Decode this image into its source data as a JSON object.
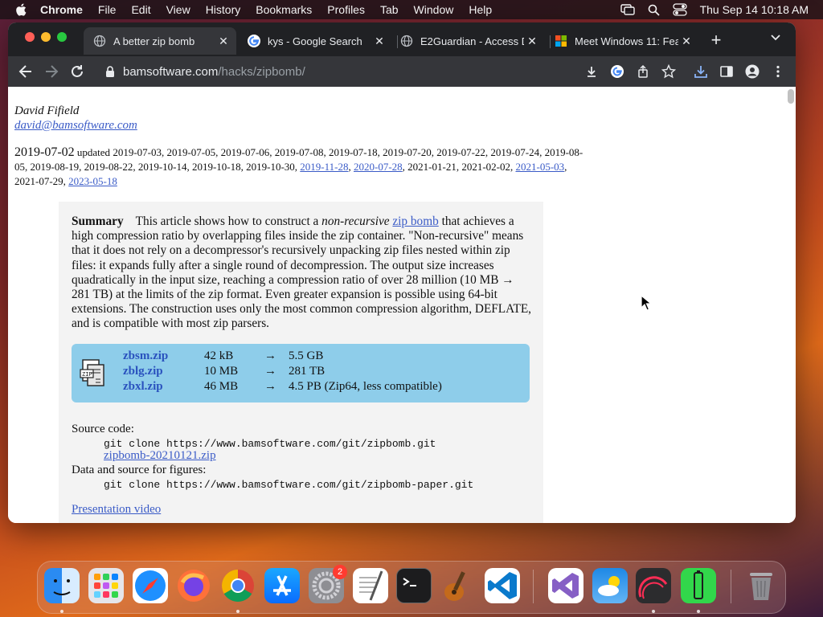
{
  "menubar": {
    "app": "Chrome",
    "items": [
      "File",
      "Edit",
      "View",
      "History",
      "Bookmarks",
      "Profiles",
      "Tab",
      "Window",
      "Help"
    ],
    "clock": "Thu Sep 14  10:18 AM"
  },
  "tabs": [
    {
      "title": "A better zip bomb",
      "favicon": "globe-icon",
      "active": true
    },
    {
      "title": "kys - Google Search",
      "favicon": "google-icon",
      "active": false
    },
    {
      "title": "E2Guardian - Access D",
      "favicon": "globe-icon",
      "active": false
    },
    {
      "title": "Meet Windows 11: Fea",
      "favicon": "microsoft-icon",
      "active": false
    }
  ],
  "address": {
    "host": "bamsoftware.com",
    "path": "/hacks/zipbomb/"
  },
  "page": {
    "author": "David Fifield",
    "email": "david@bamsoftware.com",
    "date_main": "2019-07-02",
    "updated_prefix": "updated",
    "updated_dates_plain1": "2019-07-03, 2019-07-05, 2019-07-06, 2019-07-08, 2019-07-18, 2019-07-20, 2019-07-22, 2019-07-24, 2019-08-05, 2019-08-19, 2019-08-22, 2019-10-14, 2019-10-18, 2019-10-30,",
    "link_date1": "2019-11-28",
    "link_date2": "2020-07-28",
    "updated_dates_plain2": ", 2021-01-21, 2021-02-02,",
    "link_date3": "2021-05-03",
    "updated_dates_plain3": "2021-07-29,",
    "link_date4": "2023-05-18",
    "summary_heading": "Summary",
    "summary_p1": "This article shows how to construct a",
    "summary_em": "non-recursive",
    "summary_link": "zip bomb",
    "summary_p2": "that achieves a high compression ratio by overlapping files inside the zip container. \"Non-recursive\" means that it does not rely on a decompressor's recursively unpacking zip files nested within zip files: it expands fully after a single round of decompression. The output size increases quadratically in the input size, reaching a compression ratio of over 28 million (10 MB → 281 TB) at the limits of the zip format. Even greater expansion is possible using 64-bit extensions. The construction uses only the most common compression algorithm, DEFLATE, and is compatible with most zip parsers.",
    "downloads": [
      {
        "name": "zbsm.zip",
        "size": "42 kB",
        "arrow": "→",
        "output": "5.5 GB"
      },
      {
        "name": "zblg.zip",
        "size": "10 MB",
        "arrow": "→",
        "output": "281 TB"
      },
      {
        "name": "zbxl.zip",
        "size": "46 MB",
        "arrow": "→",
        "output": "4.5 PB (Zip64, less compatible)"
      }
    ],
    "source_label": "Source code:",
    "source_git": "git clone https://www.bamsoftware.com/git/zipbomb.git",
    "source_zip": "zipbomb-20210121.zip",
    "data_label": "Data and source for figures:",
    "data_git": "git clone https://www.bamsoftware.com/git/zipbomb-paper.git",
    "video_link": "Presentation video"
  },
  "dock": {
    "apps": [
      "finder-icon",
      "launchpad-icon",
      "safari-icon",
      "firefox-icon",
      "chrome-icon",
      "app-store-icon",
      "system-settings-icon",
      "textedit-icon",
      "terminal-icon",
      "garageband-icon",
      "vscode-icon",
      "visual-studio-icon",
      "weather-icon",
      "instruments-icon",
      "battery-app-icon",
      "trash-icon"
    ],
    "settings_badge": "2"
  }
}
